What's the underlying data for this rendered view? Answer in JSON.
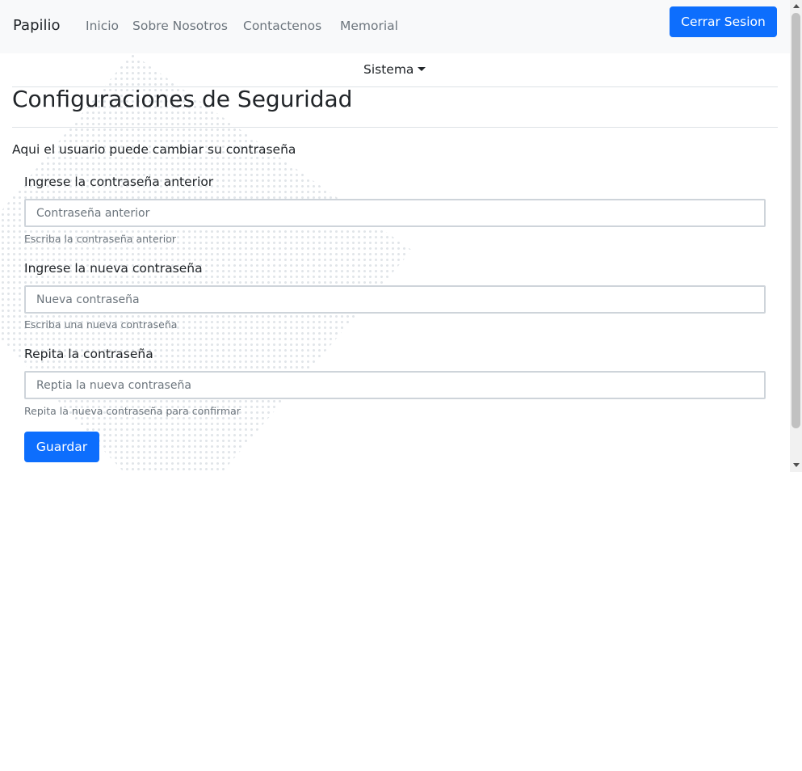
{
  "navbar": {
    "brand": "Papilio",
    "links": [
      "Inicio",
      "Sobre Nosotros",
      "Contactenos",
      "Memorial"
    ],
    "logout_label": "Cerrar Sesion"
  },
  "dropdown": {
    "label": "Sistema"
  },
  "page": {
    "title": "Configuraciones de Seguridad",
    "description": "Aqui el usuario puede cambiar su contraseña"
  },
  "form": {
    "fields": [
      {
        "label": "Ingrese la contraseña anterior",
        "placeholder": "Contraseña anterior",
        "value": "",
        "help": "Escriba la contraseña anterior"
      },
      {
        "label": "Ingrese la nueva contraseña",
        "placeholder": "Nueva contraseña",
        "value": "",
        "help": "Escriba una nueva contraseña"
      },
      {
        "label": "Repita la contraseña",
        "placeholder": "Reptia la nueva contraseña",
        "value": "",
        "help": "Repita la nueva contraseña para confirmar"
      }
    ],
    "submit_label": "Guardar"
  },
  "colors": {
    "primary": "#0d6efd",
    "navbar_bg": "#f8f9fa",
    "muted": "#6c757d",
    "text": "#212529"
  }
}
